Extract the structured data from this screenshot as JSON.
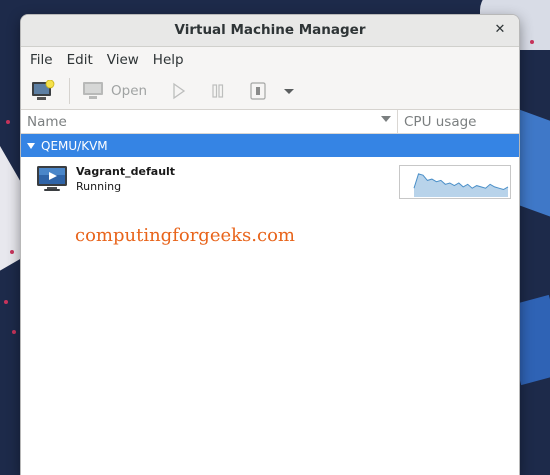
{
  "window": {
    "title": "Virtual Machine Manager"
  },
  "menubar": {
    "items": [
      "File",
      "Edit",
      "View",
      "Help"
    ]
  },
  "toolbar": {
    "open_label": "Open"
  },
  "list": {
    "columns": {
      "name": "Name",
      "cpu": "CPU usage"
    },
    "group": {
      "label": "QEMU/KVM"
    },
    "vms": [
      {
        "name": "Vagrant_default",
        "status": "Running"
      }
    ]
  },
  "watermark": "computingforgeeks.com",
  "colors": {
    "accent": "#3584e4",
    "watermark": "#e8641b",
    "graph_fill": "#b8d3ea",
    "graph_line": "#4a8fc8"
  },
  "icons": [
    "new-vm-icon",
    "monitor-icon",
    "play-icon",
    "pause-icon",
    "power-icon",
    "chevron-down-icon",
    "close-icon",
    "vm-screen-icon"
  ],
  "cpu_usage_graph": [
    0.3,
    0.85,
    0.8,
    0.6,
    0.65,
    0.55,
    0.6,
    0.45,
    0.5,
    0.4,
    0.5,
    0.35,
    0.45,
    0.3,
    0.4,
    0.35,
    0.3,
    0.45,
    0.35,
    0.3,
    0.25,
    0.35
  ]
}
